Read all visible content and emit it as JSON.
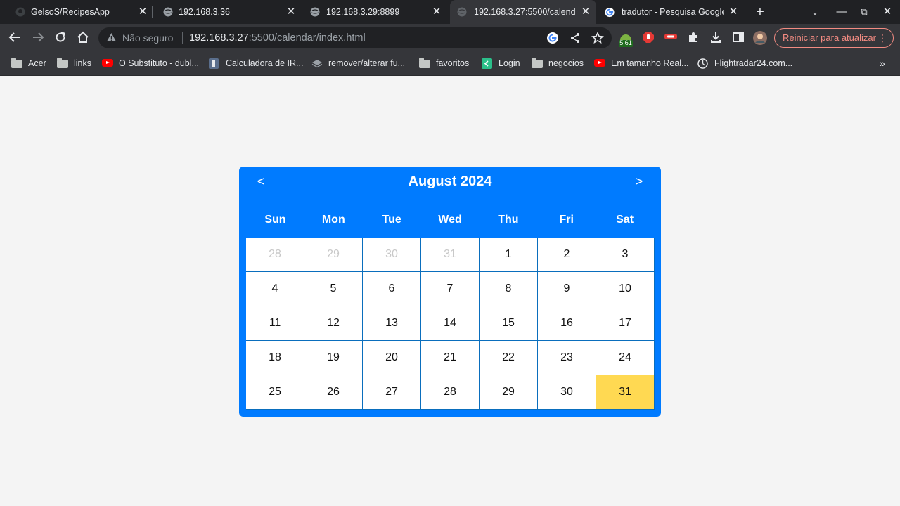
{
  "browser": {
    "tabs": [
      {
        "title": "GelsoS/RecipesApp",
        "icon": "github-icon",
        "active": false
      },
      {
        "title": "192.168.3.36",
        "icon": "globe-icon",
        "active": false
      },
      {
        "title": "192.168.3.29:8899",
        "icon": "globe-icon",
        "active": false
      },
      {
        "title": "192.168.3.27:5500/calend",
        "icon": "globe-icon",
        "active": true
      },
      {
        "title": "tradutor - Pesquisa Google",
        "icon": "google-icon",
        "active": false
      }
    ],
    "new_tab": "+",
    "omnibox": {
      "security_label": "Não seguro",
      "host": "192.168.3.27",
      "path": ":5500/calendar/index.html"
    },
    "extension_badge": "5,61",
    "update_button": "Reiniciar para atualizar",
    "bookmarks": [
      {
        "label": "Acer",
        "icon": "folder-icon"
      },
      {
        "label": "links",
        "icon": "folder-icon"
      },
      {
        "label": "O Substituto - dubl...",
        "icon": "youtube-icon"
      },
      {
        "label": "Calculadora de IR...",
        "icon": "calculator-icon"
      },
      {
        "label": "remover/alterar fu...",
        "icon": "layers-icon"
      },
      {
        "label": "favoritos",
        "icon": "folder-icon"
      },
      {
        "label": "Login",
        "icon": "login-icon"
      },
      {
        "label": "negocios",
        "icon": "folder-icon"
      },
      {
        "label": "Em tamanho Real...",
        "icon": "youtube-icon"
      },
      {
        "label": "Flightradar24.com...",
        "icon": "radar-icon"
      }
    ]
  },
  "calendar": {
    "title": "August 2024",
    "prev_label": "<",
    "next_label": ">",
    "weekdays": [
      "Sun",
      "Mon",
      "Tue",
      "Wed",
      "Thu",
      "Fri",
      "Sat"
    ],
    "days": [
      {
        "n": "28",
        "other": true
      },
      {
        "n": "29",
        "other": true
      },
      {
        "n": "30",
        "other": true
      },
      {
        "n": "31",
        "other": true
      },
      {
        "n": "1"
      },
      {
        "n": "2"
      },
      {
        "n": "3"
      },
      {
        "n": "4"
      },
      {
        "n": "5"
      },
      {
        "n": "6"
      },
      {
        "n": "7"
      },
      {
        "n": "8"
      },
      {
        "n": "9"
      },
      {
        "n": "10"
      },
      {
        "n": "11"
      },
      {
        "n": "12"
      },
      {
        "n": "13"
      },
      {
        "n": "14"
      },
      {
        "n": "15"
      },
      {
        "n": "16"
      },
      {
        "n": "17"
      },
      {
        "n": "18"
      },
      {
        "n": "19"
      },
      {
        "n": "20"
      },
      {
        "n": "21"
      },
      {
        "n": "22"
      },
      {
        "n": "23"
      },
      {
        "n": "24"
      },
      {
        "n": "25"
      },
      {
        "n": "26"
      },
      {
        "n": "27"
      },
      {
        "n": "28"
      },
      {
        "n": "29"
      },
      {
        "n": "30"
      },
      {
        "n": "31",
        "today": true
      }
    ],
    "colors": {
      "accent": "#007bff",
      "today": "#ffd952",
      "other_month_text": "#c8c8c8"
    }
  }
}
